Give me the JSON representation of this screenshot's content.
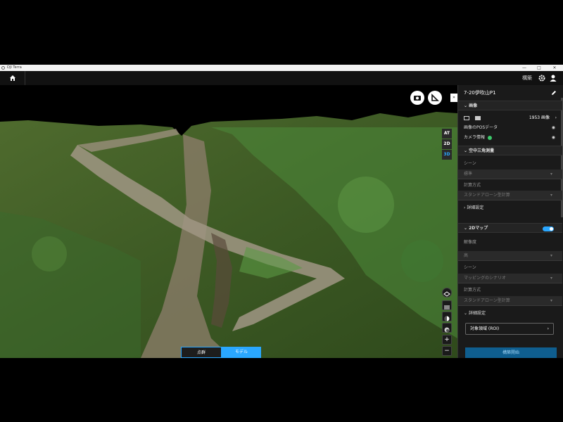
{
  "window": {
    "title": "DJI Terra",
    "minimize": "—",
    "maximize": "□",
    "close": "✕"
  },
  "topbar": {
    "label": "構築"
  },
  "viewport": {
    "view_modes": [
      "AT",
      "2D",
      "3D"
    ],
    "active_view": "3D",
    "tabs": [
      "点群",
      "モデル"
    ],
    "zoom_in": "+",
    "zoom_out": "−"
  },
  "panel": {
    "mission_name": "7-20伊吹山P1",
    "images_section": "画像",
    "image_count": "1953 画像",
    "pos_label": "画像のPOSデータ",
    "camera_label": "カメラ情報",
    "aerial_section": "空中三角測量",
    "scene_label": "シーン",
    "scene_value": "標準",
    "calc_label": "計算方式",
    "calc_value": "スタンドアローン型計算",
    "advanced_label": "詳細設定",
    "map2d_section": "2Dマップ",
    "resolution_label": "解像度",
    "resolution_value": "高",
    "scene2_label": "シーン",
    "scene2_value": "マッピングのシナリオ",
    "calc2_label": "計算方式",
    "calc2_value": "スタンドアローン型計算",
    "advanced2_label": "詳細設定",
    "roi_label": "対象領域 (ROI)",
    "start_label": "構築開始"
  },
  "colors": {
    "accent": "#2aa7ff",
    "panel_bg": "#1a1a1a",
    "camera_ok": "#3cc96b"
  }
}
